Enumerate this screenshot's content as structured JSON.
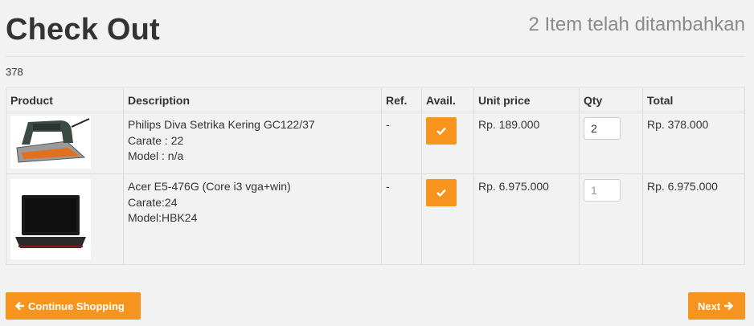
{
  "header": {
    "title": "Check Out",
    "subtitle": "2 Item telah ditambahkan"
  },
  "cart_total_raw": "378",
  "table": {
    "columns": [
      "Product",
      "Description",
      "Ref.",
      "Avail.",
      "Unit price",
      "Qty",
      "Total"
    ],
    "rows": [
      {
        "image": "steam-iron",
        "description": [
          "Philips Diva Setrika Kering GC122/37",
          "Carate : 22",
          "Model : n/a"
        ],
        "ref": "-",
        "unit_price": "Rp. 189.000",
        "qty": "2",
        "total": "Rp. 378.000"
      },
      {
        "image": "laptop",
        "description": [
          "Acer E5-476G (Core i3 vga+win)",
          "Carate:24",
          "Model:HBK24"
        ],
        "ref": "-",
        "unit_price": "Rp. 6.975.000",
        "qty_placeholder": "1",
        "total": "Rp. 6.975.000"
      }
    ]
  },
  "buttons": {
    "continue_label": "Continue Shopping",
    "next_label": "Next"
  },
  "colors": {
    "accent": "#f7941d",
    "background": "#f2f2f2"
  }
}
